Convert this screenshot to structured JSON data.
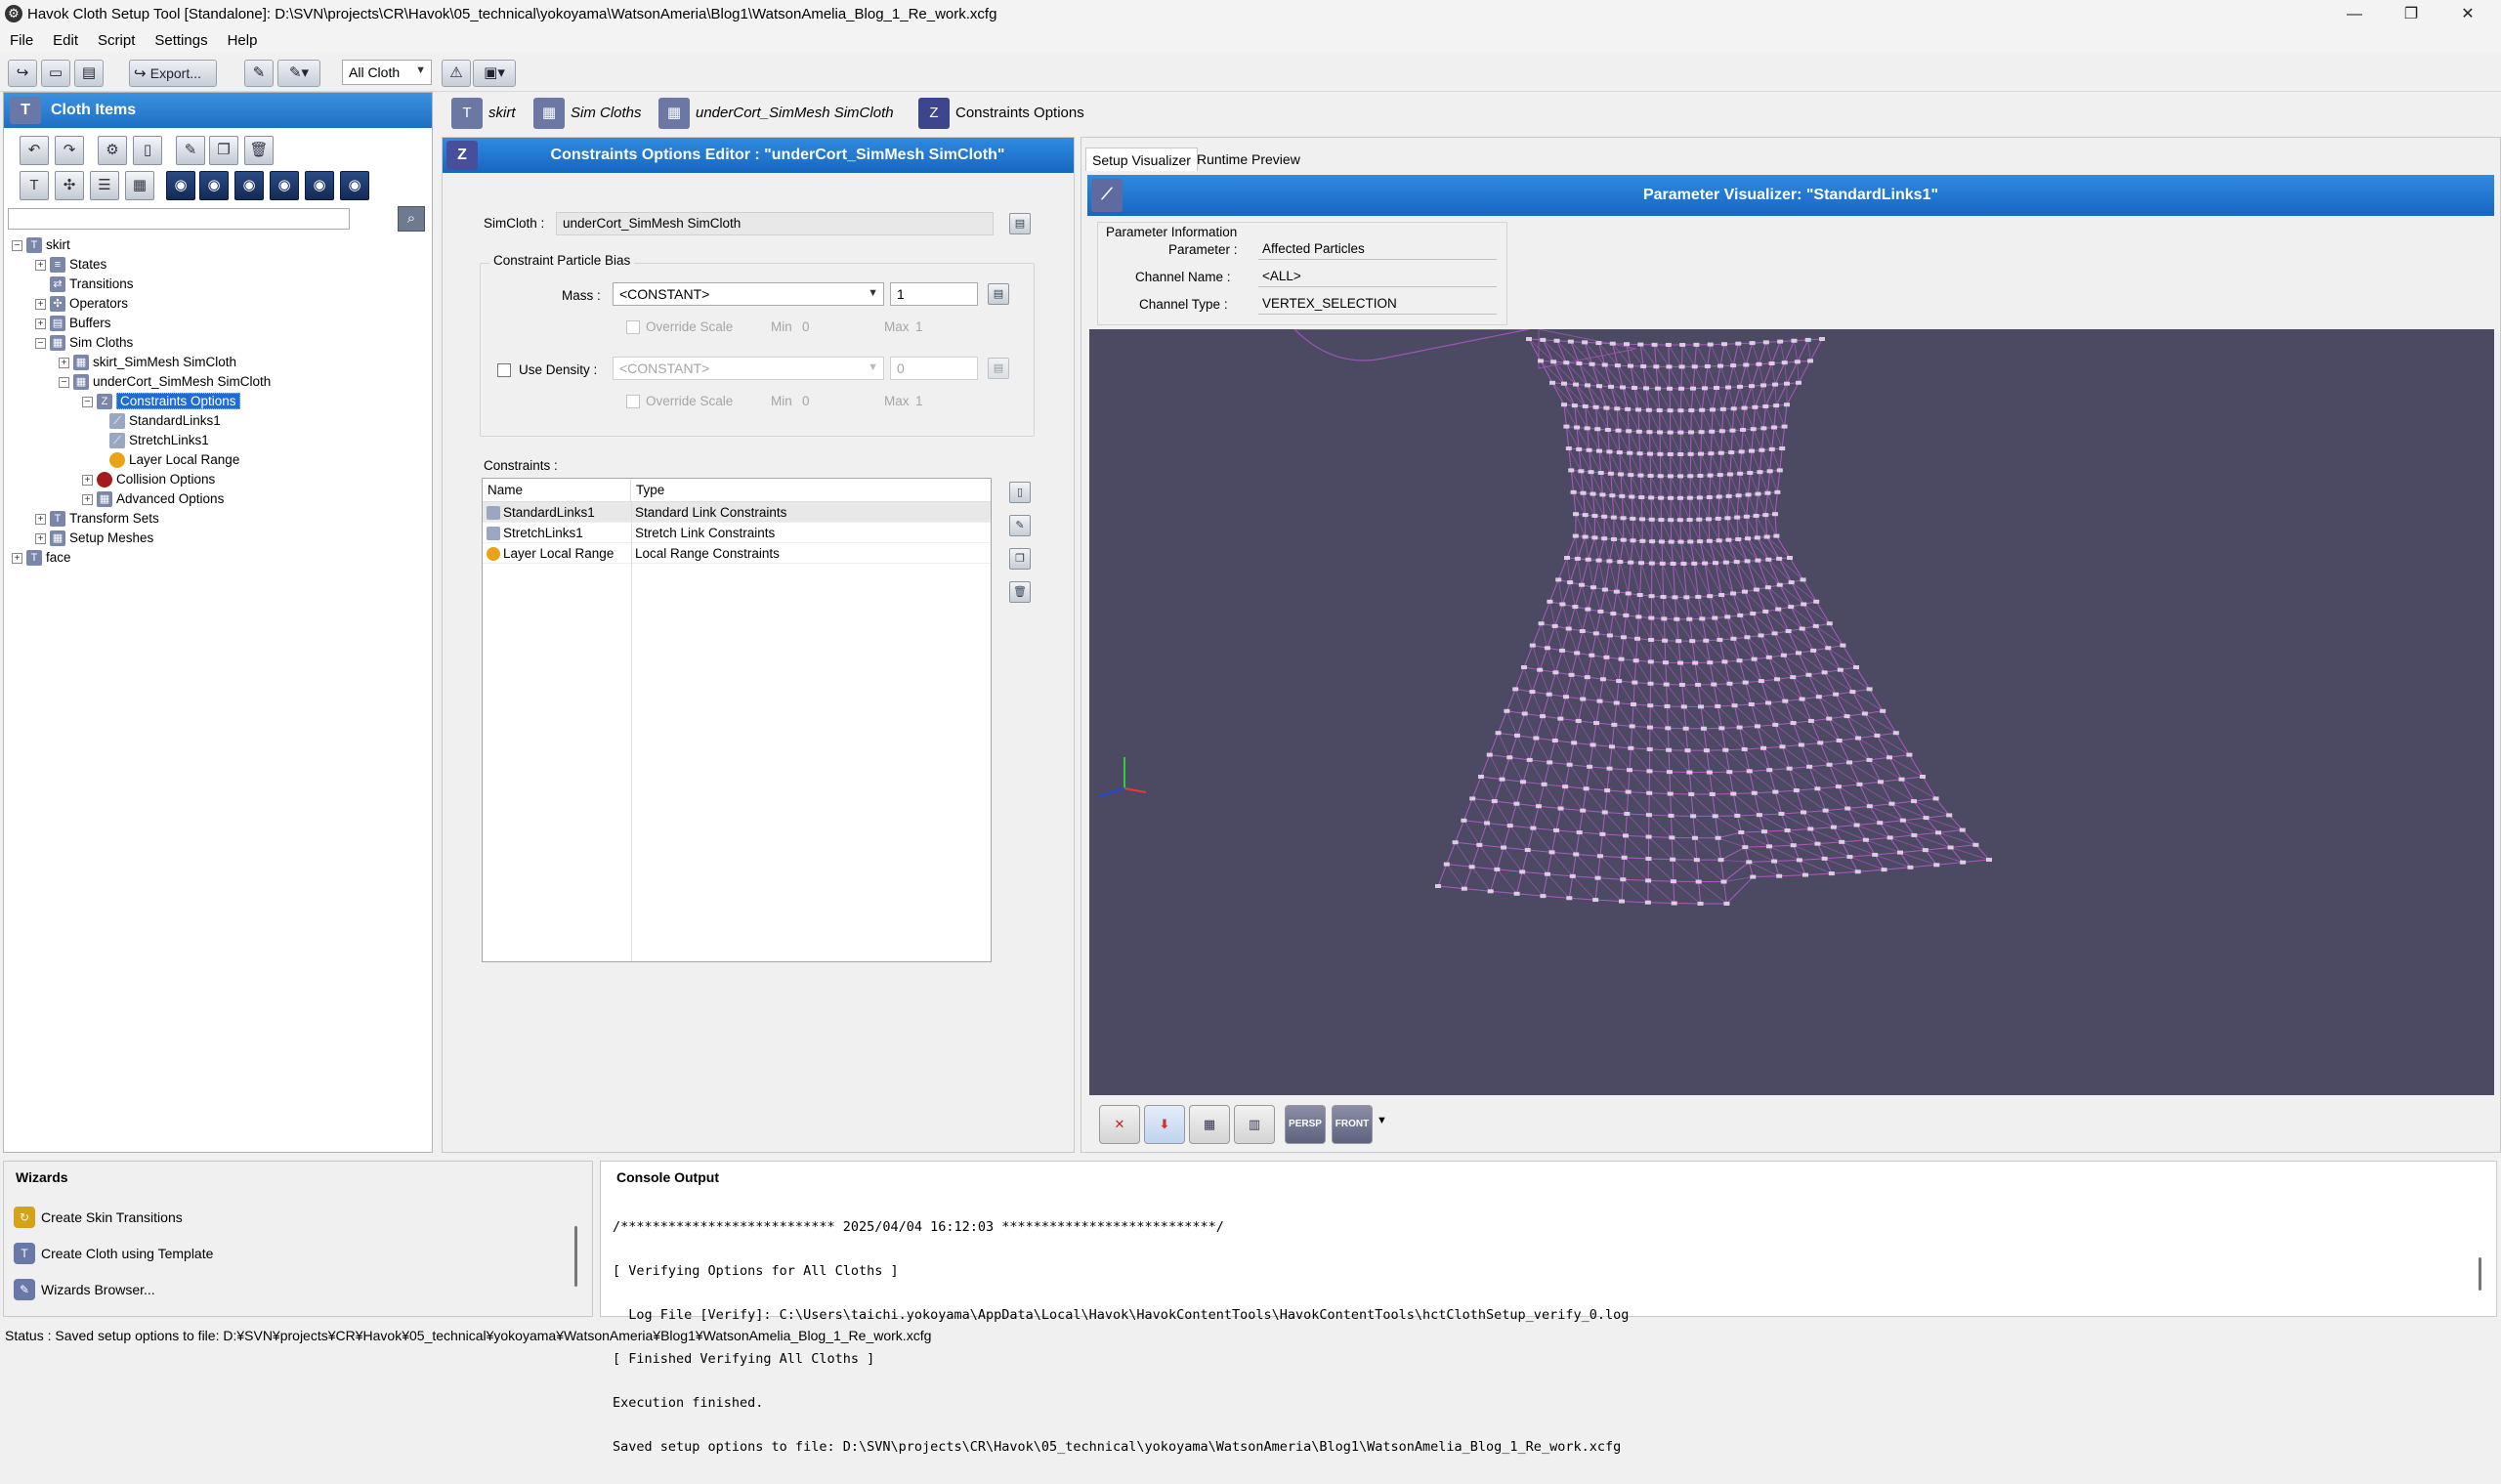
{
  "window": {
    "title": "Havok Cloth Setup Tool [Standalone]: D:\\SVN\\projects\\CR\\Havok\\05_technical\\yokoyama\\WatsonAmeria\\Blog1\\WatsonAmelia_Blog_1_Re_work.xcfg",
    "minimize": "—",
    "restore": "❐",
    "close": "✕"
  },
  "menu": [
    "File",
    "Edit",
    "Script",
    "Settings",
    "Help"
  ],
  "toolbar": {
    "export_label": "Export...",
    "filter_value": "All Cloth"
  },
  "cloth_items": {
    "title": "Cloth Items",
    "tree": [
      {
        "label": "skirt"
      },
      {
        "label": "States"
      },
      {
        "label": "Transitions"
      },
      {
        "label": "Operators"
      },
      {
        "label": "Buffers"
      },
      {
        "label": "Sim Cloths"
      },
      {
        "label": "skirt_SimMesh SimCloth"
      },
      {
        "label": "underCort_SimMesh SimCloth"
      },
      {
        "label": "Constraints Options"
      },
      {
        "label": "StandardLinks1"
      },
      {
        "label": "StretchLinks1"
      },
      {
        "label": "Layer Local Range"
      },
      {
        "label": "Collision Options"
      },
      {
        "label": "Advanced Options"
      },
      {
        "label": "Transform Sets"
      },
      {
        "label": "Setup Meshes"
      },
      {
        "label": "face"
      }
    ]
  },
  "breadcrumb": [
    "skirt",
    "Sim Cloths",
    "underCort_SimMesh SimCloth",
    "Constraints Options"
  ],
  "editor": {
    "title": "Constraints Options Editor : \"underCort_SimMesh SimCloth\"",
    "simcloth_label": "SimCloth :",
    "simcloth_value": "underCort_SimMesh SimCloth",
    "bias_group": "Constraint Particle Bias",
    "mass_label": "Mass :",
    "mass_channel": "<CONSTANT>",
    "mass_value": "1",
    "override_scale": "Override Scale",
    "min_label": "Min",
    "max_label": "Max",
    "mass_min": "0",
    "mass_max": "1",
    "use_density_label": "Use Density :",
    "density_channel": "<CONSTANT>",
    "density_value": "0",
    "density_min": "0",
    "density_max": "1",
    "constraints_label": "Constraints :",
    "col_name": "Name",
    "col_type": "Type",
    "rows": [
      {
        "name": "StandardLinks1",
        "type": "Standard Link Constraints"
      },
      {
        "name": "StretchLinks1",
        "type": "Stretch Link Constraints"
      },
      {
        "name": "Layer Local Range",
        "type": "Local Range Constraints"
      }
    ]
  },
  "visualizer": {
    "tab_setup": "Setup Visualizer",
    "tab_runtime": "Runtime Preview",
    "title": "Parameter Visualizer: \"StandardLinks1\"",
    "info_group": "Parameter Information",
    "parameter_label": "Parameter :",
    "parameter_value": "Affected Particles",
    "channel_name_label": "Channel Name :",
    "channel_name_value": "<ALL>",
    "channel_type_label": "Channel Type :",
    "channel_type_value": "VERTEX_SELECTION",
    "btn_persp": "PERSP",
    "btn_front": "FRONT",
    "mesh_color": "#c15ad6",
    "background_color": "#4c4a63"
  },
  "wizards": {
    "title": "Wizards",
    "items": [
      "Create Skin Transitions",
      "Create Cloth using Template",
      "Wizards Browser..."
    ]
  },
  "console": {
    "title": "Console Output",
    "lines": [
      "/*************************** 2025/04/04 16:12:03 ***************************/",
      "[ Verifying Options for All Cloths ]",
      "  Log File [Verify]: C:\\Users\\taichi.yokoyama\\AppData\\Local\\Havok\\HavokContentTools\\HavokContentTools\\hctClothSetup_verify_0.log",
      "[ Finished Verifying All Cloths ]",
      "Execution finished.",
      "Saved setup options to file: D:\\SVN\\projects\\CR\\Havok\\05_technical\\yokoyama\\WatsonAmeria\\Blog1\\WatsonAmelia_Blog_1_Re_work.xcfg"
    ]
  },
  "status": "Status : Saved setup options to file: D:¥SVN¥projects¥CR¥Havok¥05_technical¥yokoyama¥WatsonAmeria¥Blog1¥WatsonAmelia_Blog_1_Re_work.xcfg"
}
